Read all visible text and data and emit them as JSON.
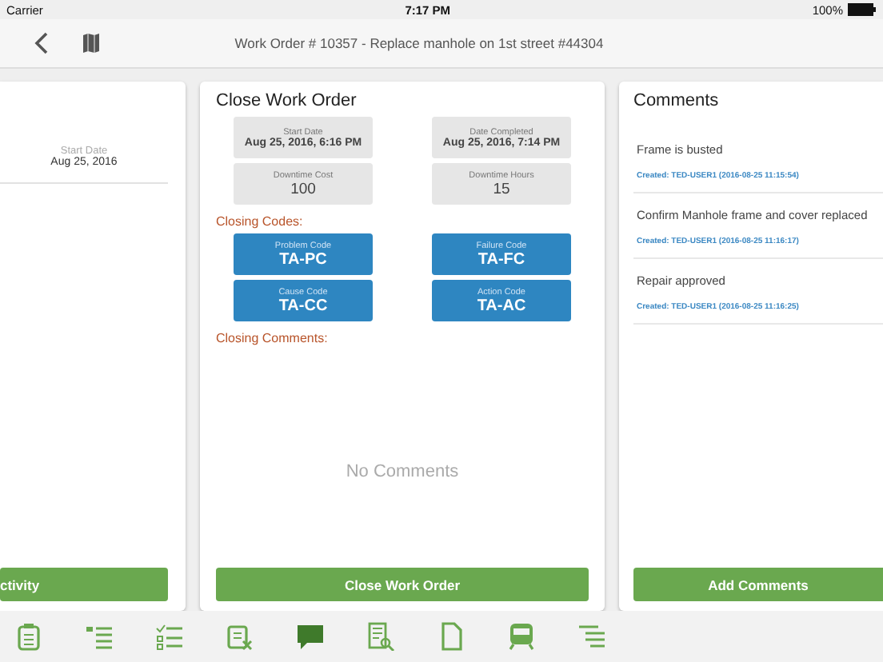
{
  "status_bar": {
    "carrier": "Carrier",
    "time": "7:17 PM",
    "battery": "100%"
  },
  "nav": {
    "title": "Work Order # 10357 - Replace manhole on 1st street #44304"
  },
  "left_panel": {
    "field_label": "Start Date",
    "field_value": "Aug 25, 2016",
    "button": "ctivity"
  },
  "close_panel": {
    "title": "Close Work Order",
    "fields": [
      {
        "label": "Start Date",
        "value": "Aug 25, 2016, 6:16 PM",
        "kind": "date"
      },
      {
        "label": "Date Completed",
        "value": "Aug 25, 2016, 7:14 PM",
        "kind": "date"
      },
      {
        "label": "Downtime Cost",
        "value": "100",
        "kind": "number"
      },
      {
        "label": "Downtime Hours",
        "value": "15",
        "kind": "number"
      }
    ],
    "codes_heading": "Closing Codes:",
    "codes": [
      {
        "label": "Problem Code",
        "value": "TA-PC"
      },
      {
        "label": "Failure Code",
        "value": "TA-FC"
      },
      {
        "label": "Cause Code",
        "value": "TA-CC"
      },
      {
        "label": "Action Code",
        "value": "TA-AC"
      }
    ],
    "comments_heading": "Closing Comments:",
    "empty_text": "No Comments",
    "button": "Close Work Order"
  },
  "comments_panel": {
    "title": "Comments",
    "comments": [
      {
        "text": "Frame is busted",
        "meta": "Created: TED-USER1 (2016-08-25 11:15:54)"
      },
      {
        "text": "Confirm Manhole frame and cover replaced",
        "meta": "Created: TED-USER1 (2016-08-25 11:16:17)"
      },
      {
        "text": "Repair approved",
        "meta": "Created: TED-USER1 (2016-08-25 11:16:25)"
      }
    ],
    "button": "Add Comments"
  },
  "tab_bar": [
    {
      "kind": "clipboard",
      "selected": false
    },
    {
      "kind": "list",
      "selected": false
    },
    {
      "kind": "checklist",
      "selected": false
    },
    {
      "kind": "clipboard-x",
      "selected": false
    },
    {
      "kind": "comment",
      "selected": true
    },
    {
      "kind": "doc-search",
      "selected": false
    },
    {
      "kind": "page",
      "selected": false
    },
    {
      "kind": "train",
      "selected": false
    },
    {
      "kind": "tree",
      "selected": false
    }
  ]
}
